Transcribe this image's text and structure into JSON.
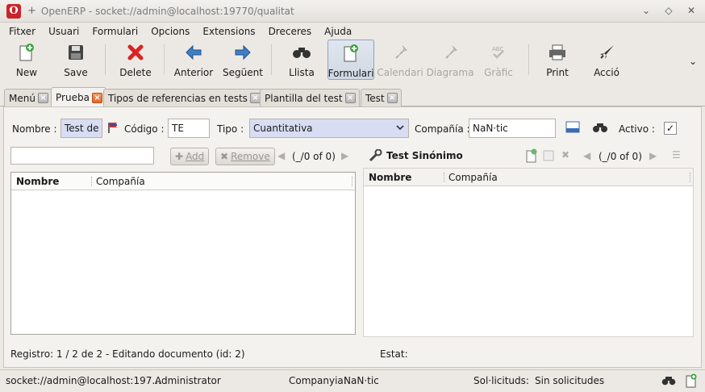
{
  "window": {
    "logo": "O",
    "plus": "+",
    "title": "OpenERP - socket://admin@localhost:19770/qualitat",
    "controls": [
      "⌄",
      "◇",
      "✕"
    ]
  },
  "menu": [
    "Fitxer",
    "Usuari",
    "Formulari",
    "Opcions",
    "Extensions",
    "Dreceres",
    "Ajuda"
  ],
  "toolbar": {
    "new": "New",
    "save": "Save",
    "delete": "Delete",
    "previous": "Anterior",
    "next": "Següent",
    "list": "Llista",
    "form": "Formulari",
    "calendar": "Calendari",
    "diagram": "Diagrama",
    "graph": "Gràfic",
    "print": "Print",
    "action": "Acció",
    "more": "⌄"
  },
  "tabs": [
    {
      "label": "Menú"
    },
    {
      "label": "Prueba"
    },
    {
      "label": "Tipos de referencias en tests"
    },
    {
      "label": "Plantilla del test"
    },
    {
      "label": "Test"
    }
  ],
  "form": {
    "nombre_label": "Nombre :",
    "nombre_value": "Test de",
    "codigo_label": "Código :",
    "codigo_value": "TE",
    "tipo_label": "Tipo :",
    "tipo_value": "Cuantitativa",
    "compania_label": "Compañía :",
    "compania_value": "NaN·tic",
    "activo_label": "Activo :",
    "activo_checked": "✓"
  },
  "left_grid": {
    "add_label": "Add",
    "remove_label": "Remove",
    "nav": "(_/0 of 0)",
    "columns": [
      "Nombre",
      "Compañía"
    ]
  },
  "right_grid": {
    "title": "Test Sinónimo",
    "nav": "(_/0 of 0)",
    "columns": [
      "Nombre",
      "Compañía"
    ]
  },
  "record_status": "Registro: 1 / 2 de 2 - Editando documento (id: 2)",
  "estat_label": "Estat:",
  "statusbar": {
    "connection": "socket://admin@localhost:197...",
    "user": "Administrator",
    "company_label": "Companyia:",
    "company_value": "NaN·tic",
    "requests_label": "Sol·licituds:",
    "requests_value": "Sin solicitudes"
  }
}
